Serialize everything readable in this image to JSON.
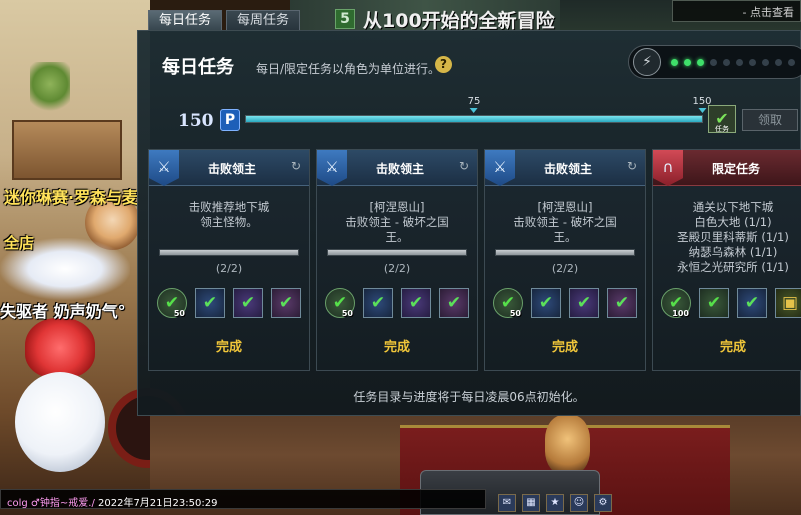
{
  "background": {
    "banner_level": "5",
    "banner_text": "从100开始的全新冒险",
    "top_right_box": "- 点击查看",
    "left_text_1": "迷你琳赛·罗森与麦",
    "left_text_2": "全店",
    "left_text_3": "失驱者 奶声奶气°"
  },
  "tabs": [
    {
      "label": "每日任务",
      "active": true
    },
    {
      "label": "每周任务",
      "active": false
    }
  ],
  "header": {
    "title": "每日任务",
    "subtitle": "每日/限定任务以角色为单位进行。",
    "help_icon": "question-icon"
  },
  "energy": {
    "icon": "lightning-icon",
    "dots_total": 10,
    "dots_on": 3
  },
  "progress": {
    "current": "150",
    "points_icon_letter": "P",
    "max": 150,
    "value": 150,
    "milestones": [
      {
        "value": 75,
        "label": "75"
      },
      {
        "value": 150,
        "label": "150"
      }
    ],
    "reward_icon_label": "任务",
    "claim_label": "领取"
  },
  "cards": [
    {
      "type": "boss",
      "title": "击败领主",
      "description_lines": [
        "击败推荐地下城",
        "领主怪物。"
      ],
      "progress_text": "(2/2)",
      "progress": 1.0,
      "rewards": [
        {
          "style": "green round",
          "qty": "50"
        },
        {
          "style": "blue",
          "qty": ""
        },
        {
          "style": "purple",
          "qty": ""
        },
        {
          "style": "purple2",
          "qty": ""
        }
      ],
      "status": "完成"
    },
    {
      "type": "boss",
      "title": "击败领主",
      "description_lines": [
        "[柯涅恩山]",
        "击败领主 - 破坏之国",
        "王。"
      ],
      "progress_text": "(2/2)",
      "progress": 1.0,
      "rewards": [
        {
          "style": "green round",
          "qty": "50"
        },
        {
          "style": "blue",
          "qty": ""
        },
        {
          "style": "purple",
          "qty": ""
        },
        {
          "style": "purple2",
          "qty": ""
        }
      ],
      "status": "完成"
    },
    {
      "type": "boss",
      "title": "击败领主",
      "description_lines": [
        "[柯涅恩山]",
        "击败领主 - 破坏之国",
        "王。"
      ],
      "progress_text": "(2/2)",
      "progress": 1.0,
      "rewards": [
        {
          "style": "green round",
          "qty": "50"
        },
        {
          "style": "blue",
          "qty": ""
        },
        {
          "style": "purple",
          "qty": ""
        },
        {
          "style": "purple2",
          "qty": ""
        }
      ],
      "status": "完成"
    },
    {
      "type": "limited",
      "title": "限定任务",
      "description_lines": [
        "通关以下地下城",
        "白色大地 (1/1)",
        "圣殿贝里科蒂斯 (1/1)",
        "纳瑟乌森林 (1/1)",
        "永恒之光研究所 (1/1)"
      ],
      "progress_text": "",
      "progress": null,
      "rewards": [
        {
          "style": "green round",
          "qty": "100"
        },
        {
          "style": "green",
          "qty": ""
        },
        {
          "style": "blue",
          "qty": ""
        },
        {
          "style": "box",
          "qty": ""
        }
      ],
      "status": "完成"
    }
  ],
  "reset_note": "任务目录与进度将于每日凌晨06点初始化。",
  "chat": {
    "name": "colg ♂钟指~戒爱./",
    "timestamp": "2022年7月21日23:50:29"
  }
}
